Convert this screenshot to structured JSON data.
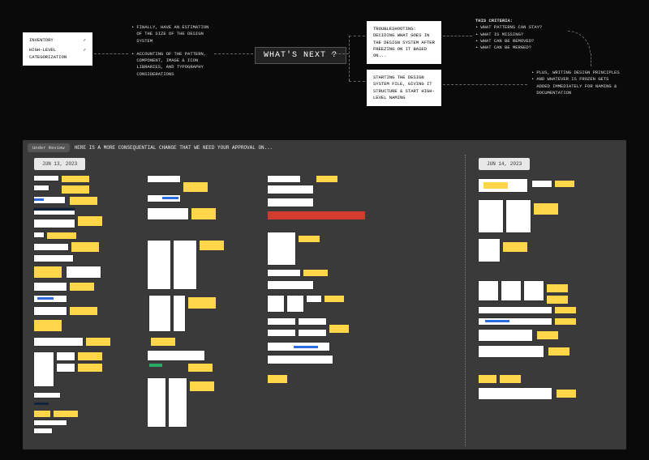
{
  "flow": {
    "inventory_card": {
      "row1": "INVENTORY",
      "row2": "HIGH-LEVEL CATEGORIZATION",
      "check": "✓"
    },
    "estimation_bullets": [
      "FINALLY, HAVE AN ESTIMATION OF THE SIZE OF THE DESIGN SYSTEM",
      "ACCOUNTING OF THE PATTERN, COMPONENT, IMAGE & ICON LIBRARIES, AND TYPOGRAPHY CONSIDERATIONS"
    ],
    "whats_next": "WHAT'S NEXT ?",
    "troubleshooting_card": "TROUBLESHOOTING: DECIDING WHAT GOES IN THE DESIGN SYSTEM AFTER FREEZING ON IT BASED ON...",
    "starting_card": "STARTING THE DESIGN SYSTEM FILE, GIVING IT STRUCTURE & START HIGH-LEVEL NAMING",
    "criteria": {
      "heading": "THIS CRITERIA:",
      "items": [
        "WHAT PATTERNS CAN STAY?",
        "WHAT IS MISSING?",
        "WHAT CAN BE REMOVED?",
        "WHAT CAN BE MERGED?"
      ]
    },
    "principles_bullets": [
      "PLUS, WRITING DESIGN PRINCIPLES",
      "AND WHATEVER IS FROZEN GETS ADDED IMMEDIATELY FOR NAMING & DOCUMENTATION"
    ]
  },
  "review": {
    "badge": "Under Review",
    "heading": "HERE IS A MORE CONSEQUENTIAL CHANGE THAT WE NEED YOUR APPROVAL ON...",
    "date_left": "JUN 13, 2023",
    "date_right": "JUN 14, 2023"
  }
}
